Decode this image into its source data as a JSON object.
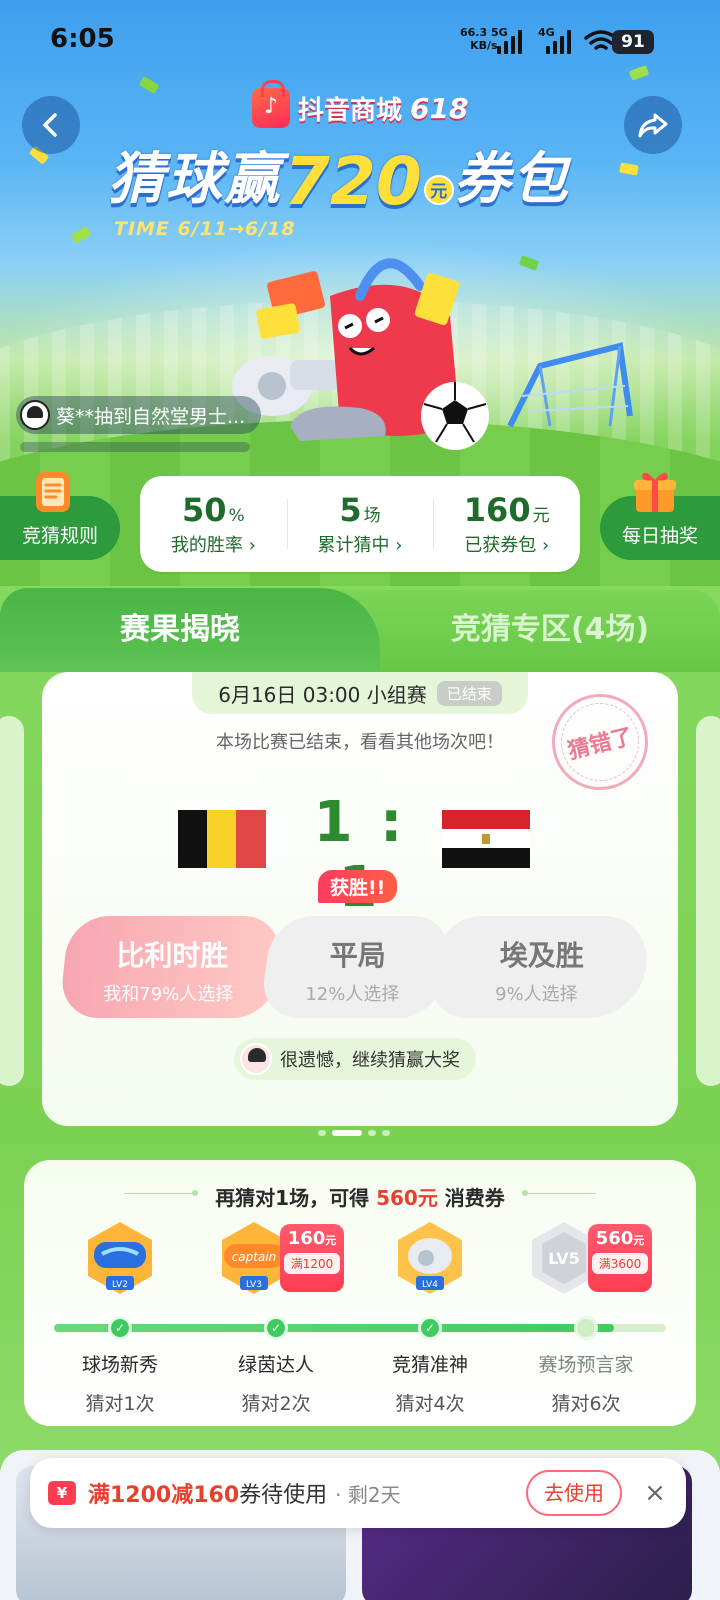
{
  "status_bar": {
    "time": "6:05",
    "net_speed_value": "66.3",
    "net_speed_unit": "KB/s",
    "net_5g": "5G",
    "net_4g": "4G",
    "battery": "91"
  },
  "hero": {
    "brand": "抖音商城",
    "brand_suffix": "618",
    "title_prefix": "猜球赢",
    "title_amount": "720",
    "title_unit": "元",
    "title_suffix": "券包",
    "time_range": "TIME 6/11→6/18",
    "marquee": "葵**抽到自然堂男士..."
  },
  "side_buttons": {
    "rules": "竞猜规则",
    "daily_draw": "每日抽奖"
  },
  "stats": [
    {
      "value": "50",
      "unit": "%",
      "label": "我的胜率 ›"
    },
    {
      "value": "5",
      "unit": "场",
      "label": "累计猜中 ›"
    },
    {
      "value": "160",
      "unit": "元",
      "label": "已获券包 ›"
    }
  ],
  "tabs": {
    "active": "赛果揭晓",
    "inactive": "竞猜专区(4场)"
  },
  "match": {
    "header": "6月16日 03:00 小组赛",
    "status": "已结束",
    "stamp": "猜错了",
    "note": "本场比赛已结束，看看其他场次吧！",
    "score": "1 : 1",
    "win_tag": "获胜!!",
    "options": [
      {
        "title": "比利时胜",
        "sub": "我和79%人选择"
      },
      {
        "title": "平局",
        "sub": "12%人选择"
      },
      {
        "title": "埃及胜",
        "sub": "9%人选择"
      }
    ],
    "encourage": "很遗憾，继续猜赢大奖"
  },
  "progress": {
    "title_a": "再猜对1场，可得 ",
    "title_amount": "560元",
    "title_b": " 消费券",
    "rewards": [
      {
        "amount": "160",
        "unit": "元",
        "cond": "满1200"
      },
      {
        "amount": "560",
        "unit": "元",
        "cond": "满3600"
      }
    ],
    "levels": [
      {
        "name": "球场新秀",
        "cond": "猜对1次"
      },
      {
        "name": "绿茵达人",
        "cond": "猜对2次"
      },
      {
        "name": "竞猜准神",
        "cond": "猜对4次"
      },
      {
        "name": "赛场预言家",
        "cond": "猜对6次"
      }
    ],
    "medal_text": [
      "LV2",
      "captain",
      "LV4",
      "LV5"
    ],
    "completed_levels": 3
  },
  "toast": {
    "coupon_icon": "¥",
    "highlight": "满1200减160",
    "text": "券待使用",
    "remaining": "· 剩2天",
    "button": "去使用",
    "close": "×"
  },
  "colors": {
    "primary_green": "#2d9a3c",
    "accent_red": "#e8402e",
    "sky_blue": "#3f9fef"
  }
}
